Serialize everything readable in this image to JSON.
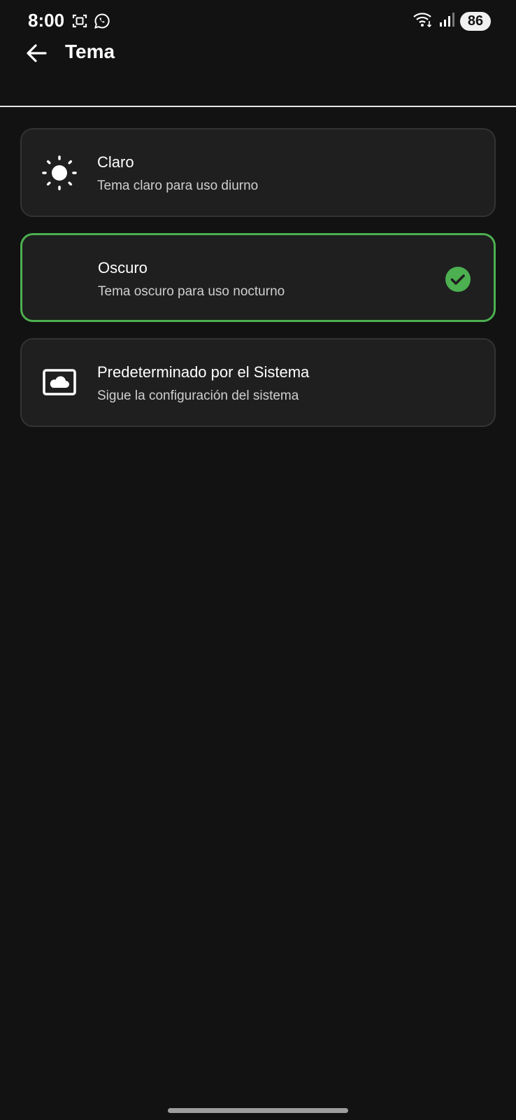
{
  "status_bar": {
    "time": "8:00",
    "battery": "86",
    "icons": [
      "screenshot-icon",
      "whatsapp-icon",
      "wifi-icon",
      "signal-icon"
    ]
  },
  "header": {
    "title": "Tema",
    "back_icon": "arrow-back-icon"
  },
  "options": [
    {
      "title": "Claro",
      "subtitle": "Tema claro para uso diurno",
      "icon": "sun-icon",
      "selected": false
    },
    {
      "title": "Oscuro",
      "subtitle": "Tema oscuro para uso nocturno",
      "icon": "moon-icon",
      "selected": true
    },
    {
      "title": "Predeterminado por el Sistema",
      "subtitle": "Sigue la configuración del sistema",
      "icon": "system-cloud-icon",
      "selected": false
    }
  ],
  "colors": {
    "background": "#121212",
    "card": "#1f1f1f",
    "accent": "#4caf50"
  }
}
